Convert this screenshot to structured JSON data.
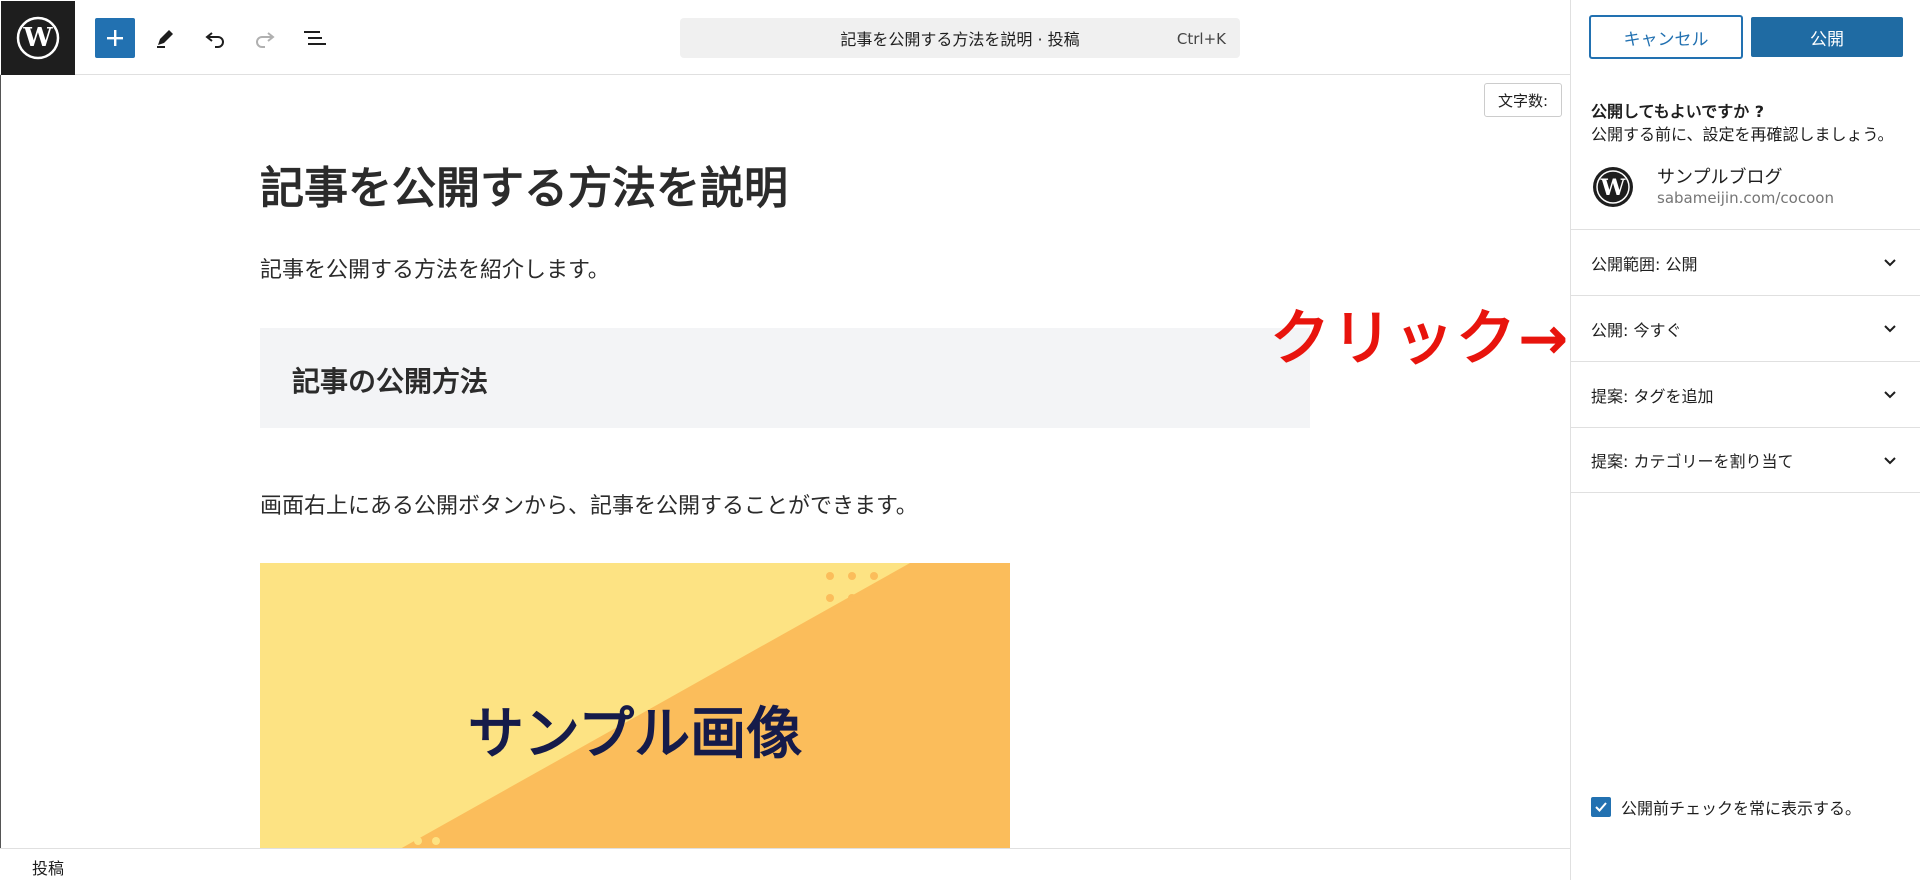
{
  "header": {
    "command_bar_title": "記事を公開する方法を説明 · 投稿",
    "command_shortcut": "Ctrl+K"
  },
  "editor": {
    "word_count_label": "文字数:",
    "post_title": "記事を公開する方法を説明",
    "intro_paragraph": "記事を公開する方法を紹介します。",
    "section_heading": "記事の公開方法",
    "body_paragraph": "画面右上にある公開ボタンから、記事を公開することができます。",
    "image_text": "サンプル画像"
  },
  "annotation": {
    "text": "クリック→",
    "color": "#e8140d"
  },
  "sidebar": {
    "cancel_label": "キャンセル",
    "publish_label": "公開",
    "question": "公開してもよいですか ?",
    "subtext": "公開する前に、設定を再確認しましょう。",
    "site_name": "サンプルブログ",
    "site_url": "sabameijin.com/cocoon",
    "panels": [
      {
        "label": "公開範囲: 公開"
      },
      {
        "label": "公開: 今すぐ"
      },
      {
        "label": "提案: タグを追加"
      },
      {
        "label": "提案: カテゴリーを割り当て"
      }
    ],
    "always_show_label": "公開前チェックを常に表示する。",
    "always_show_checked": true
  },
  "footer": {
    "breadcrumb": "投稿"
  },
  "colors": {
    "accent": "#2271b1",
    "publish_button": "#1f6ba3",
    "image_yellow": "#fde383",
    "image_orange": "#fbbd5b"
  },
  "icons": [
    "wordpress-logo-icon",
    "plus-icon",
    "pen-icon",
    "undo-icon",
    "redo-icon",
    "list-view-icon",
    "chevron-down-icon",
    "checkmark-icon"
  ]
}
